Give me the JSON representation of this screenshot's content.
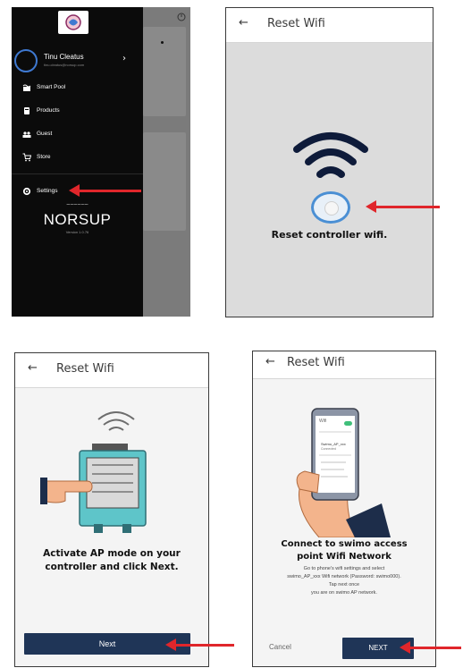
{
  "panel1": {
    "user_name": "Tinu Cleatus",
    "user_email": "tinu.cleatus@norsup.com",
    "menu": [
      {
        "label": "Smart Pool",
        "icon": "pool-icon"
      },
      {
        "label": "Products",
        "icon": "product-icon"
      },
      {
        "label": "Guest",
        "icon": "guest-icon"
      },
      {
        "label": "Store",
        "icon": "cart-icon"
      },
      {
        "label": "Settings",
        "icon": "gear-icon"
      }
    ],
    "brand_wave": "~~~~~~",
    "brand_name": "NORSUP",
    "version": "Version 1.0.76"
  },
  "panel2": {
    "back": "←",
    "title": "Reset Wifi",
    "caption": "Reset controller wifi."
  },
  "panel3": {
    "back": "←",
    "title": "Reset Wifi",
    "heading_line1": "Activate AP mode on your",
    "heading_line2": "controller and click Next.",
    "next_label": "Next"
  },
  "panel4": {
    "back": "←",
    "title": "Reset Wifi",
    "phone_wifi_label": "Wifi",
    "phone_network_name": "Swimo_AP_xxx",
    "phone_network_status": "Connected",
    "heading_line1": "Connect to swimo access",
    "heading_line2": "point Wifi Network",
    "instr_line1": "Go to phone's wifi settings and select",
    "instr_line2": "swimo_AP_xxx Wifi network (Password: swimo000).",
    "instr_line3": "Tap next once",
    "instr_line4": "you are on swimo AP network.",
    "cancel_label": "Cancel",
    "next_label": "NEXT"
  },
  "colors": {
    "accent_red": "#e0262b",
    "button_navy": "#1f3557",
    "drawer_black": "#0b0b0b",
    "avatar_ring": "#3f79d1"
  }
}
